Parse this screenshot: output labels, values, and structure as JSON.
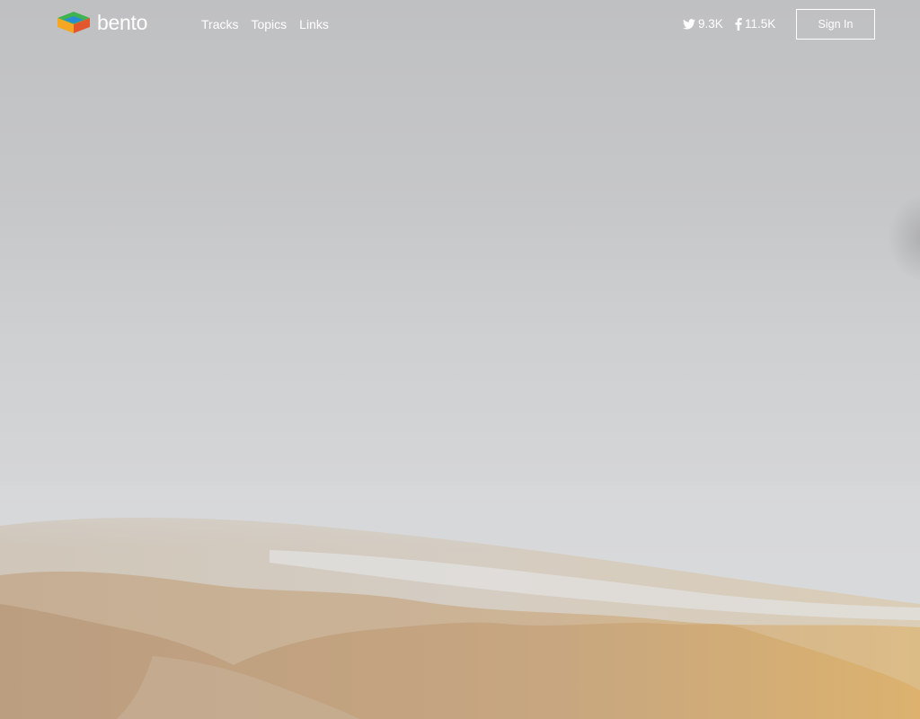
{
  "brand": {
    "name": "bento",
    "logo_icon": "bento-cube-logo-icon"
  },
  "nav": {
    "items": [
      {
        "label": "Tracks"
      },
      {
        "label": "Topics"
      },
      {
        "label": "Links"
      }
    ]
  },
  "social": {
    "twitter": {
      "icon": "twitter-bird-icon",
      "count": "9.3K"
    },
    "facebook": {
      "icon": "facebook-f-icon",
      "count": "11.5K"
    }
  },
  "auth": {
    "signin_label": "Sign In"
  },
  "hero": {
    "background": "misty-mountain-landscape"
  },
  "colors": {
    "text": "#ffffff",
    "logo_green": "#3fb34f",
    "logo_blue": "#2a8dd4",
    "logo_orange": "#f5a623",
    "logo_red": "#e4572e",
    "mountain_gold": "#d2b07a"
  }
}
